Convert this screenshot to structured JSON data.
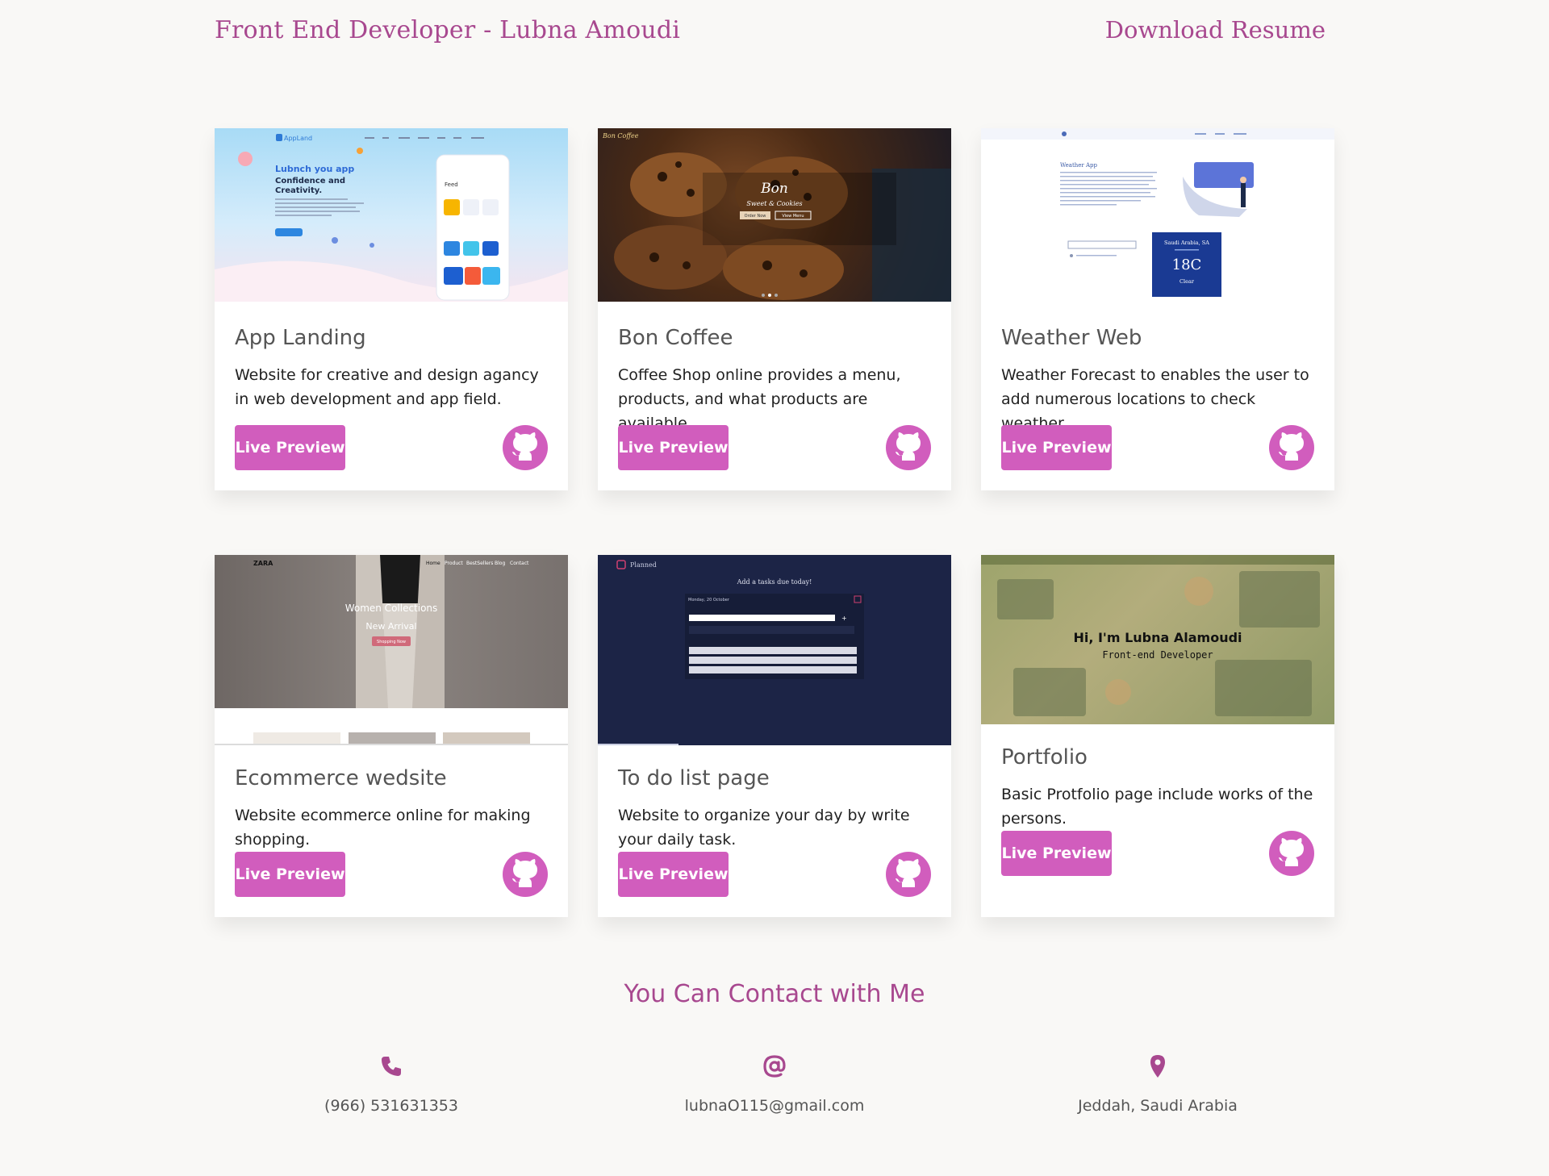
{
  "header": {
    "brand": "Front End Developer - Lubna Amoudi",
    "resume_link": "Download Resume"
  },
  "colors": {
    "accent": "#a8488f",
    "button": "#d15dbd",
    "background": "#f9f8f6"
  },
  "projects": [
    {
      "title": "App Landing",
      "description": "Website for creative and design agancy in web development and app field.",
      "preview_label": "Live Preview",
      "github_icon": "github-icon",
      "thumbnail": {
        "nav_logo": "AppLand",
        "headline_1": "Lubnch you app",
        "headline_2": "With Confidence and Creativity.",
        "phone_label": "Feed"
      }
    },
    {
      "title": "Bon Coffee",
      "description": "Coffee Shop online provides a menu, products, and what products are available.",
      "preview_label": "Live Preview",
      "github_icon": "github-icon",
      "thumbnail": {
        "logo": "Bon Coffee",
        "hero_1": "Bon",
        "hero_2": "Sweet & Cookies",
        "btn_1": "Order Now",
        "btn_2": "View Menu"
      }
    },
    {
      "title": "Weather Web",
      "description": "Weather Forecast to enables the user to add numerous locations to check weather.",
      "preview_label": "Live Preview",
      "github_icon": "github-icon",
      "thumbnail": {
        "app_title": "Weather App",
        "location": "Saudi Arabia, SA",
        "temp": "18C",
        "condition": "Clear"
      }
    },
    {
      "title": "Ecommerce wedsite",
      "description": "Website ecommerce online for making shopping.",
      "preview_label": "Live Preview",
      "github_icon": "github-icon",
      "thumbnail": {
        "logo": "ZARA",
        "nav": [
          "Home",
          "Product",
          "BestSellers",
          "Blog",
          "Contact"
        ],
        "hero_1": "Women Collections",
        "hero_2": "New Arrival",
        "cta": "Shopping Now"
      }
    },
    {
      "title": "To do list page",
      "description": "Website to organize your day by write your daily task.",
      "preview_label": "Live Preview",
      "github_icon": "github-icon",
      "thumbnail": {
        "logo": "Planned",
        "heading": "Add a tasks due today!",
        "date": "Monday, 20 October"
      }
    },
    {
      "title": "Portfolio",
      "description": "Basic Protfolio page include works of the persons.",
      "preview_label": "Live Preview",
      "github_icon": "github-icon",
      "thumbnail": {
        "greeting": "Hi, I'm Lubna Alamoudi",
        "role": "Front-end Developer"
      }
    }
  ],
  "contact": {
    "title": "You Can Contact with Me",
    "items": [
      {
        "icon": "phone-icon",
        "text": "(966) 531631353"
      },
      {
        "icon": "at-sign-icon",
        "text": "lubnaO115@gmail.com"
      },
      {
        "icon": "location-pin-icon",
        "text": "Jeddah, Saudi Arabia"
      }
    ]
  }
}
